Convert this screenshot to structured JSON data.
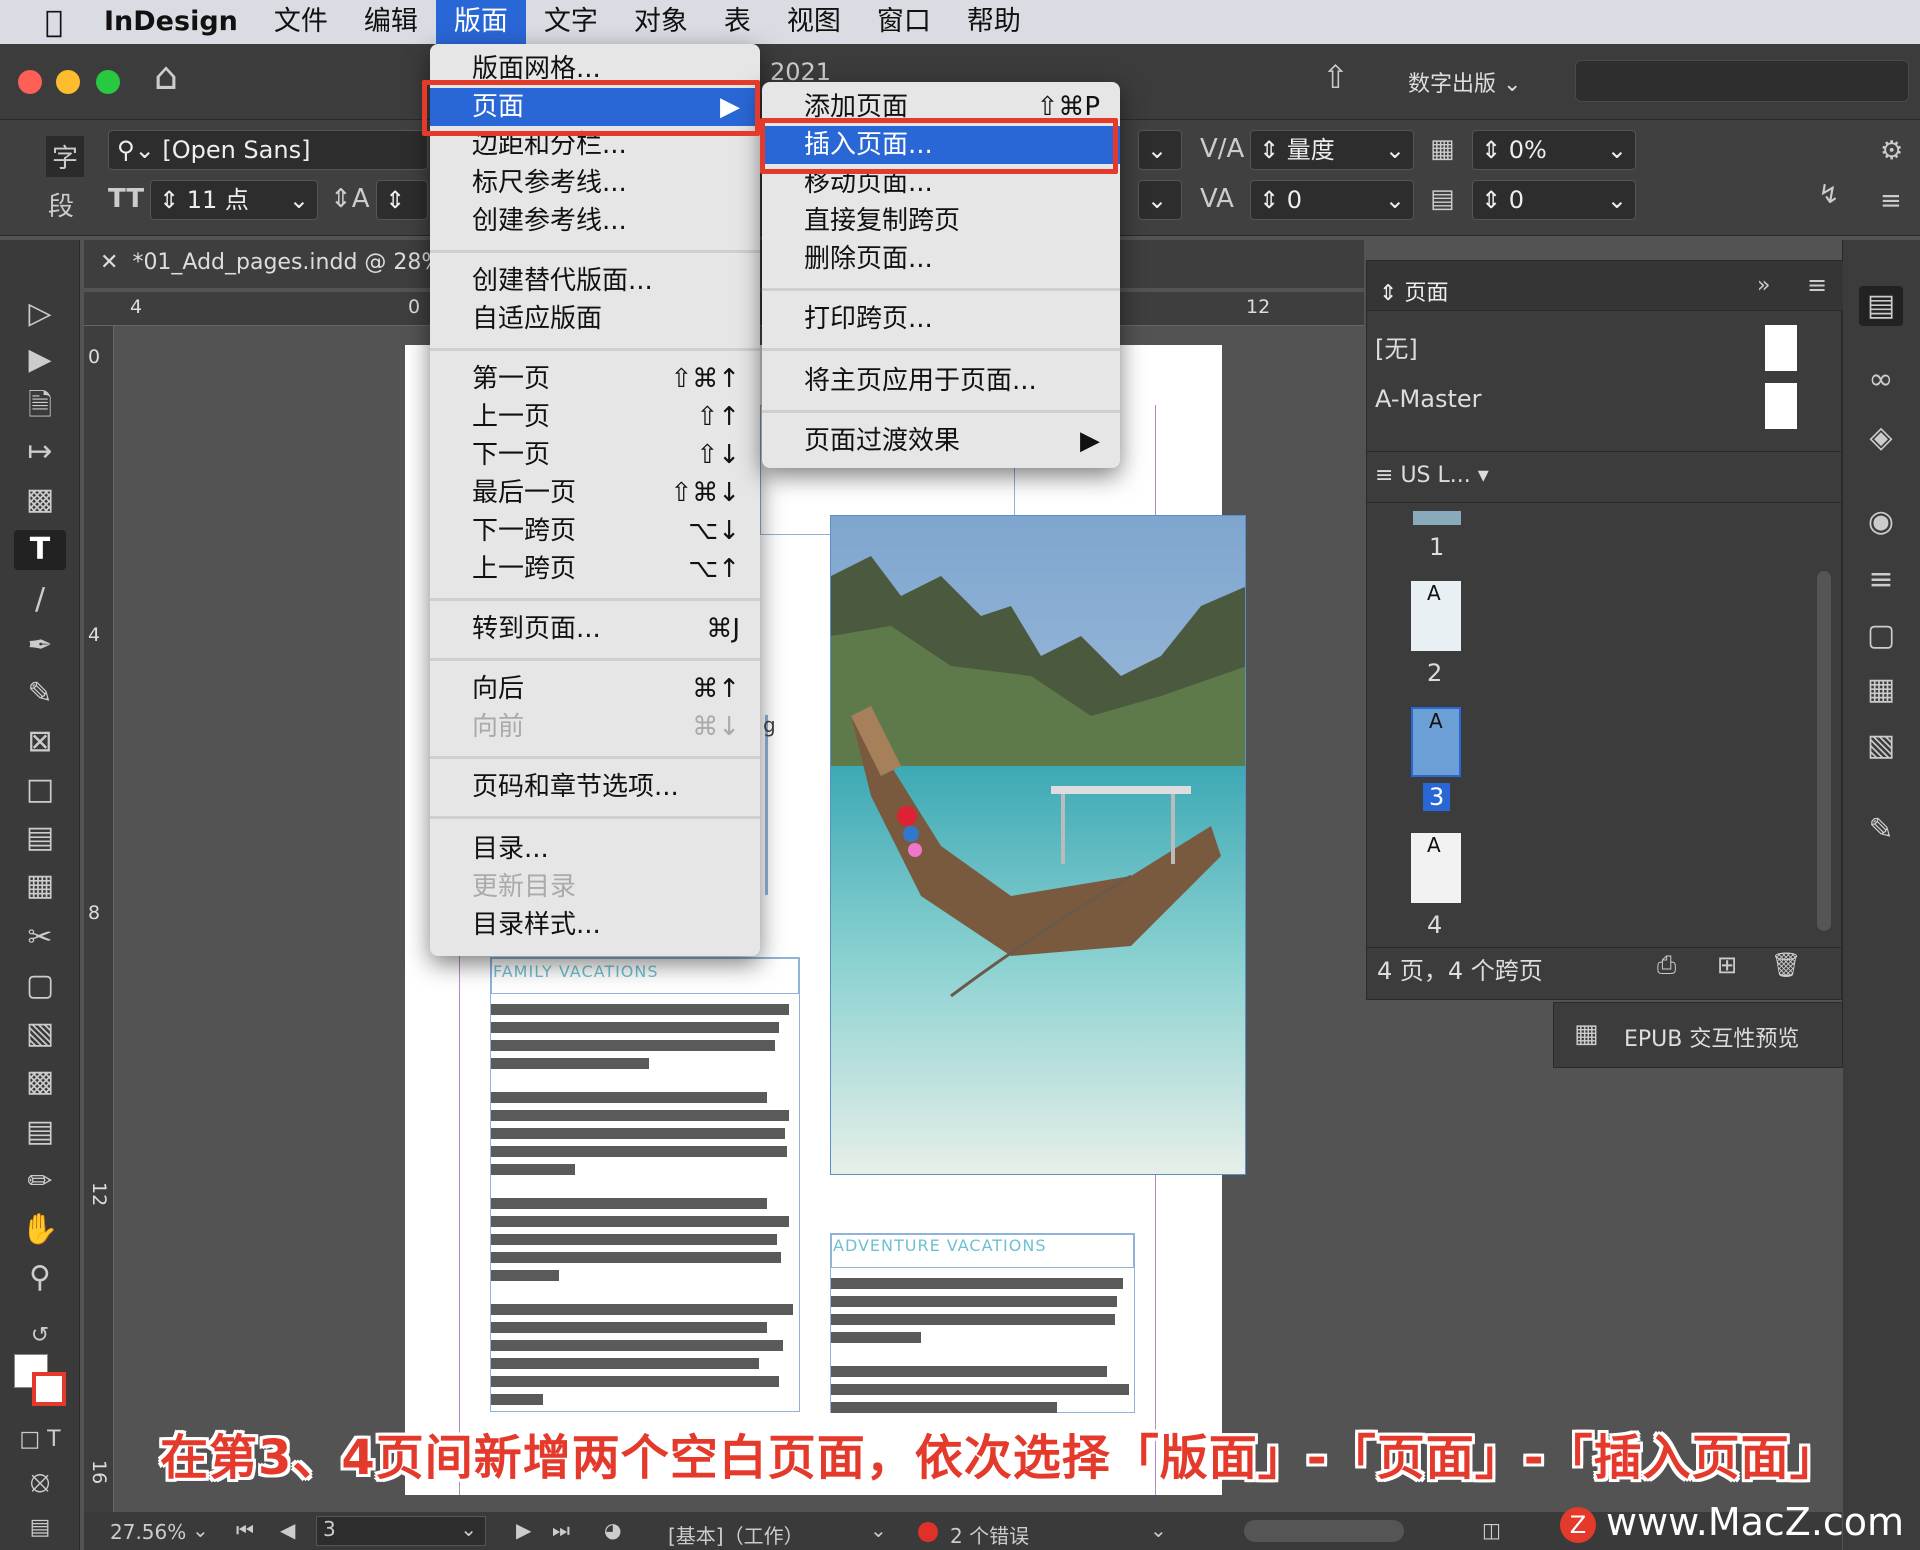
{
  "menubar": {
    "apple": "",
    "items": [
      "InDesign",
      "文件",
      "编辑",
      "版面",
      "文字",
      "对象",
      "表",
      "视图",
      "窗口",
      "帮助"
    ]
  },
  "appbar": {
    "title": "2021",
    "workspace": "数字出版",
    "home_icon": "home-icon",
    "share_icon": "share-icon"
  },
  "control": {
    "char_label": "字",
    "para_label": "段",
    "font": "[Open Sans]",
    "size": "11 点",
    "kern": "量度",
    "tracking": "0%",
    "baseline": "0",
    "skew": "0"
  },
  "document": {
    "tab": "*01_Add_pages.indd @ 28%",
    "ruler_h": [
      "4",
      "0",
      "12"
    ],
    "ruler_v": [
      "0",
      "4",
      "8",
      "12",
      "16"
    ],
    "heading_family": "FAMILY VACATIONS",
    "heading_adventure": "ADVENTURE VACATIONS",
    "partial_letter": "g"
  },
  "layout_menu": {
    "items": [
      {
        "label": "版面网格...",
        "shortcut": "",
        "disabled": false
      },
      {
        "label": "页面",
        "shortcut": "▶",
        "disabled": false
      },
      {
        "label": "边距和分栏...",
        "shortcut": "",
        "disabled": false
      },
      {
        "label": "标尺参考线...",
        "shortcut": "",
        "disabled": false
      },
      {
        "label": "创建参考线...",
        "shortcut": "",
        "disabled": false
      },
      {
        "label": "创建替代版面...",
        "shortcut": "",
        "disabled": false
      },
      {
        "label": "自适应版面",
        "shortcut": "",
        "disabled": false
      },
      {
        "label": "第一页",
        "shortcut": "⇧⌘↑",
        "disabled": false
      },
      {
        "label": "上一页",
        "shortcut": "⇧↑",
        "disabled": false
      },
      {
        "label": "下一页",
        "shortcut": "⇧↓",
        "disabled": false
      },
      {
        "label": "最后一页",
        "shortcut": "⇧⌘↓",
        "disabled": false
      },
      {
        "label": "下一跨页",
        "shortcut": "⌥↓",
        "disabled": false
      },
      {
        "label": "上一跨页",
        "shortcut": "⌥↑",
        "disabled": false
      },
      {
        "label": "转到页面...",
        "shortcut": "⌘J",
        "disabled": false
      },
      {
        "label": "向后",
        "shortcut": "⌘↑",
        "disabled": false
      },
      {
        "label": "向前",
        "shortcut": "⌘↓",
        "disabled": true
      },
      {
        "label": "页码和章节选项...",
        "shortcut": "",
        "disabled": false
      },
      {
        "label": "目录...",
        "shortcut": "",
        "disabled": false
      },
      {
        "label": "更新目录",
        "shortcut": "",
        "disabled": true
      },
      {
        "label": "目录样式...",
        "shortcut": "",
        "disabled": false
      }
    ]
  },
  "pages_submenu": {
    "items": [
      {
        "label": "添加页面",
        "shortcut": "⇧⌘P"
      },
      {
        "label": "插入页面...",
        "shortcut": ""
      },
      {
        "label": "移动页面...",
        "shortcut": ""
      },
      {
        "label": "直接复制跨页",
        "shortcut": ""
      },
      {
        "label": "删除页面...",
        "shortcut": ""
      },
      {
        "label": "打印跨页...",
        "shortcut": ""
      },
      {
        "label": "将主页应用于页面...",
        "shortcut": ""
      },
      {
        "label": "页面过渡效果",
        "shortcut": "▶"
      }
    ]
  },
  "pages_panel": {
    "title": "页面",
    "masters": [
      "[无]",
      "A-Master"
    ],
    "size_menu": "US L...",
    "pages": [
      "1",
      "2",
      "3",
      "4"
    ],
    "selected_page": "3",
    "footer": "4 页，4 个跨页"
  },
  "epub_panel": {
    "label": "EPUB 交互性预览"
  },
  "status": {
    "zoom": "27.56%",
    "page": "3",
    "profile": "[基本]（工作）",
    "errors": "2 个错误"
  },
  "caption": "在第3、4页间新增两个空白页面，依次选择「版面」-「页面」-「插入页面」",
  "watermark": "www.MacZ.com",
  "colors": {
    "accent": "#2a67d6",
    "annotation": "#e33a2c",
    "error_dot": "#e0302a"
  }
}
